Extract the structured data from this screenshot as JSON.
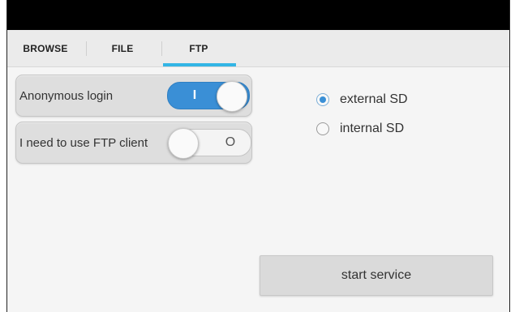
{
  "tabs": [
    {
      "label": "BROWSE",
      "selected": false
    },
    {
      "label": "FILE",
      "selected": false
    },
    {
      "label": "FTP",
      "selected": true
    }
  ],
  "settings": {
    "anonymous_login": {
      "label": "Anonymous login",
      "state": "on",
      "switch_text": "I"
    },
    "ftp_client": {
      "label": "I need to use FTP client",
      "state": "off",
      "switch_text": "O"
    }
  },
  "storage": {
    "options": [
      {
        "label": "external SD",
        "checked": true
      },
      {
        "label": "internal SD",
        "checked": false
      }
    ]
  },
  "actions": {
    "start_label": "start service"
  },
  "colors": {
    "accent": "#33b5e5",
    "switch_on": "#3a8fd6",
    "status_bar": "#000000"
  }
}
